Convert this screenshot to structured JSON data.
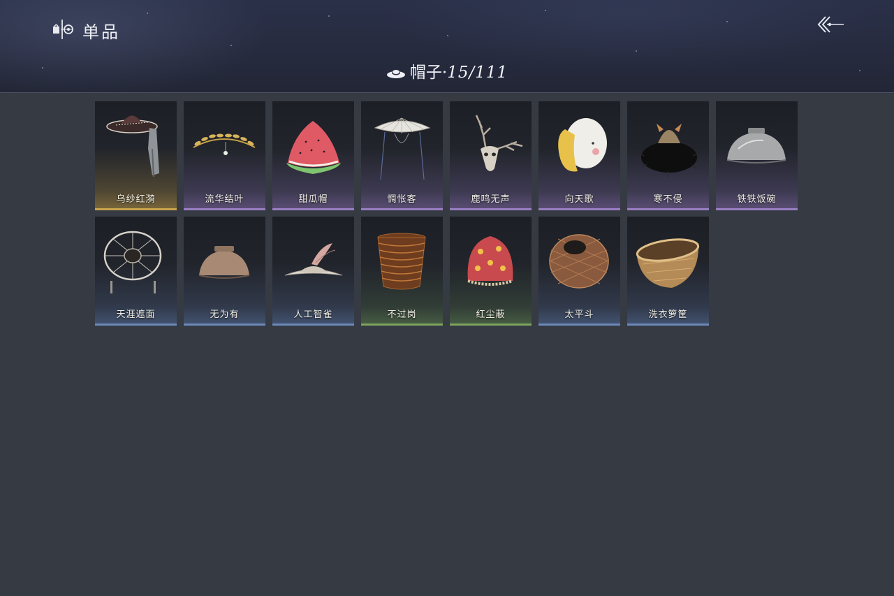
{
  "header": {
    "section_icon": "collection-icon",
    "section_title": "单品",
    "back_icon": "back-arrow-icon",
    "category_icon": "hat-icon",
    "category_label": "帽子",
    "category_separator": "·",
    "category_count": "15/111"
  },
  "items": [
    {
      "name": "乌纱红漪",
      "rarity": "gold",
      "icon": "veiled-hat-icon"
    },
    {
      "name": "流华结叶",
      "rarity": "purple",
      "icon": "laurel-crown-icon"
    },
    {
      "name": "甜瓜帽",
      "rarity": "purple",
      "icon": "watermelon-hat-icon"
    },
    {
      "name": "惆怅客",
      "rarity": "purple",
      "icon": "bamboo-hat-icon"
    },
    {
      "name": "鹿鸣无声",
      "rarity": "purple",
      "icon": "deer-skull-icon"
    },
    {
      "name": "向天歌",
      "rarity": "purple",
      "icon": "goose-hood-icon"
    },
    {
      "name": "寒不侵",
      "rarity": "purple",
      "icon": "fur-hat-icon"
    },
    {
      "name": "铁铁饭碗",
      "rarity": "purple",
      "icon": "iron-bowl-icon"
    },
    {
      "name": "天涯遮面",
      "rarity": "blue",
      "icon": "wheel-hat-icon"
    },
    {
      "name": "无为有",
      "rarity": "blue",
      "icon": "clay-bowl-icon"
    },
    {
      "name": "人工智雀",
      "rarity": "blue",
      "icon": "bird-hat-icon"
    },
    {
      "name": "不过岗",
      "rarity": "green",
      "icon": "stacked-bowls-icon"
    },
    {
      "name": "红尘蔽",
      "rarity": "green",
      "icon": "red-cloth-hat-icon"
    },
    {
      "name": "太平斗",
      "rarity": "blue",
      "icon": "wicker-basket-icon"
    },
    {
      "name": "洗衣箩筐",
      "rarity": "blue",
      "icon": "laundry-basket-icon"
    }
  ]
}
